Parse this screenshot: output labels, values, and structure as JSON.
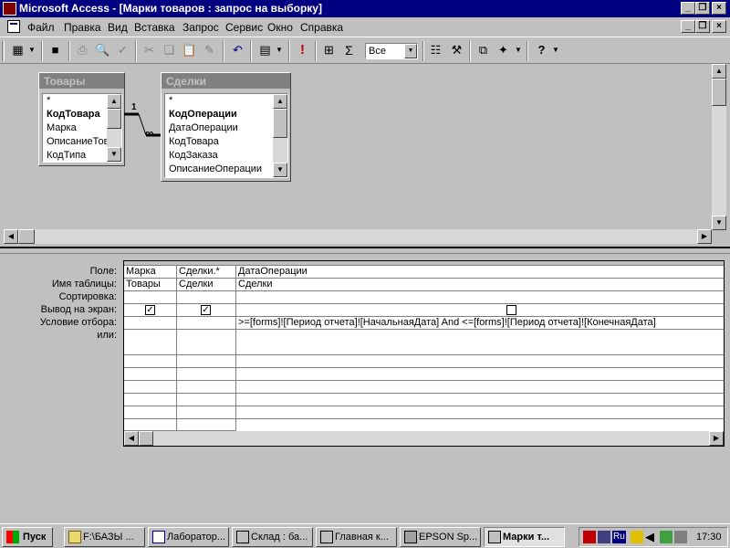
{
  "window": {
    "title": "Microsoft Access - [Марки товаров : запрос на выборку]"
  },
  "menu": [
    "Файл",
    "Правка",
    "Вид",
    "Вставка",
    "Запрос",
    "Сервис",
    "Окно",
    "Справка"
  ],
  "toolbar": {
    "top_values": "Все",
    "sum_symbol": "Σ",
    "run_symbol": "!"
  },
  "relationship": {
    "one": "1",
    "many": "∞"
  },
  "tables": {
    "tovary": {
      "title": "Товары",
      "fields": [
        "*",
        "КодТовара",
        "Марка",
        "ОписаниеТов",
        "КодТипа"
      ]
    },
    "sdelki": {
      "title": "Сделки",
      "fields": [
        "*",
        "КодОперации",
        "ДатаОперации",
        "КодТовара",
        "КодЗаказа",
        "ОписаниеОперации"
      ]
    }
  },
  "grid": {
    "row_labels": [
      "Поле:",
      "Имя таблицы:",
      "Сортировка:",
      "Вывод на экран:",
      "Условие отбора:",
      "или:"
    ],
    "columns": [
      {
        "field": "Марка",
        "table": "Товары",
        "show": true,
        "criteria": ""
      },
      {
        "field": "Сделки.*",
        "table": "Сделки",
        "show": true,
        "criteria": ""
      },
      {
        "field": "ДатаОперации",
        "table": "Сделки",
        "show": false,
        "criteria": ">=[forms]![Период отчета]![НачальнаяДата] And <=[forms]![Период отчета]![КонечнаяДата]"
      }
    ]
  },
  "taskbar": {
    "start": "Пуск",
    "tasks": [
      "F:\\БАЗЫ ...",
      "Лаборатор...",
      "Склад : ба...",
      "Главная к...",
      "EPSON Sp...",
      "Марки т..."
    ],
    "lang": "Ru",
    "clock": "17:30"
  }
}
